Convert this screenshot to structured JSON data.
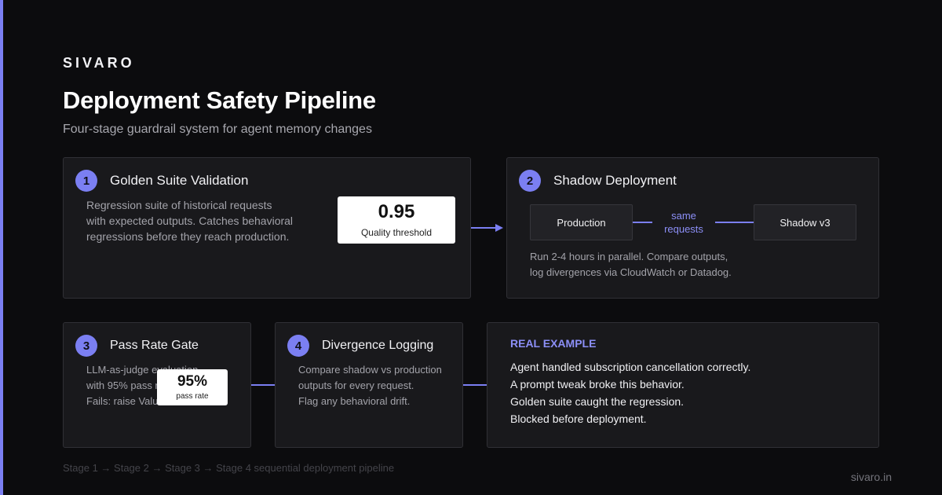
{
  "brand": "SIVARO",
  "title": "Deployment Safety Pipeline",
  "subtitle": "Four-stage guardrail system for agent memory changes",
  "colors": {
    "accent": "#7b7ff2",
    "background": "#0c0c0e",
    "card": "#19191c"
  },
  "stage1": {
    "number": "1",
    "title": "Golden Suite Validation",
    "description": [
      "Regression suite of historical requests",
      "with expected outputs. Catches behavioral",
      "regressions before they reach production."
    ],
    "stat": {
      "value": "0.95",
      "label": "Quality threshold"
    }
  },
  "stage2": {
    "number": "2",
    "title": "Shadow Deployment",
    "production_label": "Production",
    "flow_label_line1": "same",
    "flow_label_line2": "requests",
    "shadow_label": "Shadow v3",
    "description": [
      "Run 2-4 hours in parallel. Compare outputs,",
      "log divergences via CloudWatch or Datadog."
    ]
  },
  "stage3": {
    "number": "3",
    "title": "Pass Rate Gate",
    "description": [
      "LLM-as-judge evaluation",
      "with 95% pass rate",
      "Fails: raise Value"
    ],
    "stat": {
      "value": "95%",
      "label": "pass rate"
    }
  },
  "stage4": {
    "number": "4",
    "title": "Divergence Logging",
    "description": [
      "Compare shadow vs production",
      "outputs for every request.",
      "Flag any behavioral drift."
    ]
  },
  "example": {
    "label": "REAL EXAMPLE",
    "lines": [
      "Agent handled subscription cancellation correctly.",
      "A prompt tweak broke this behavior.",
      "Golden suite caught the regression.",
      "Blocked before deployment."
    ]
  },
  "footer": {
    "note": "Stage 1 → Stage 2 → Stage 3 → Stage 4 sequential deployment pipeline",
    "url": "sivaro.in"
  }
}
